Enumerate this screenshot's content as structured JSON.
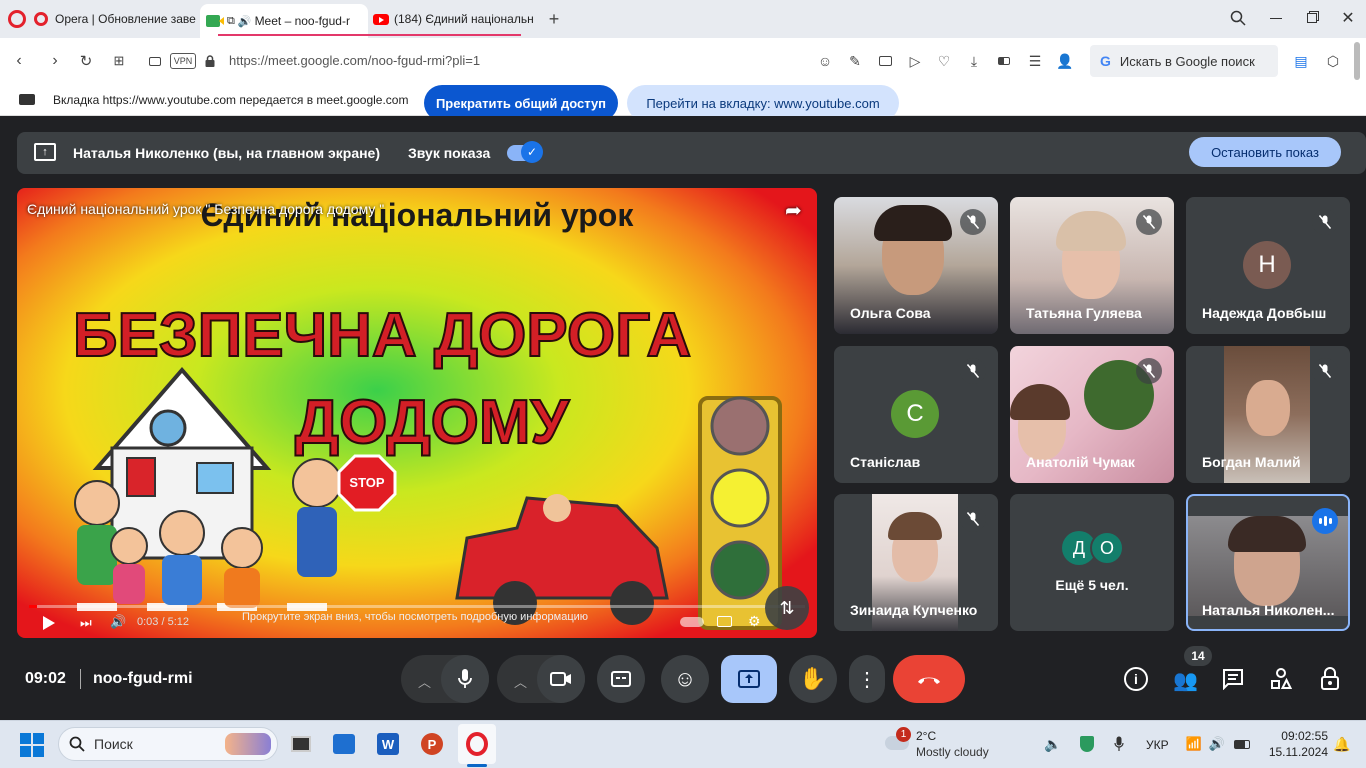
{
  "browser": {
    "tabs": [
      {
        "label": "Opera | Обновление заве"
      },
      {
        "label": "Meet – noo-fgud-r"
      },
      {
        "label": "(184) Єдиний національн"
      }
    ],
    "address_url": "https://meet.google.com/noo-fgud-rmi?pli=1",
    "vpn_label": "VPN",
    "search_placeholder": "Искать в Google поиск",
    "share_notice": "Вкладка https://www.youtube.com передается в meet.google.com",
    "stop_sharing_label": "Прекратить общий доступ",
    "goto_tab_label": "Перейти на вкладку: www.youtube.com"
  },
  "meet": {
    "presenter_label": "Наталья Николенко (вы, на главном экране)",
    "share_sound_label": "Звук показа",
    "stop_presenting_label": "Остановить показ",
    "meeting_time": "09:02",
    "meeting_code": "noo-fgud-rmi",
    "participants_count": "14",
    "video": {
      "title": "Єдиний національний урок \" Безпечна дорога додому \"",
      "banner_top": "Єдиний національний урок",
      "headline_1": "БЕЗПЕЧНА ДОРОГА",
      "headline_2": "ДОДОМУ",
      "stop_sign": "STOP",
      "time": "0:03 / 5:12",
      "scroll_hint": "Прокрутите экран вниз, чтобы посмотреть подробную информацию",
      "progress": 0.01
    },
    "participants": [
      {
        "name": "Ольга Сова"
      },
      {
        "name": "Татьяна Гуляева"
      },
      {
        "name": "Надежда Довбыш",
        "initial": "Н",
        "color": "#7a5b52"
      },
      {
        "name": "Станіслав",
        "initial": "С",
        "color": "#5a9a35"
      },
      {
        "name": "Анатолій Чумак"
      },
      {
        "name": "Богдан Малий"
      },
      {
        "name": "Зинаида Купченко"
      },
      {
        "name": "Ещё 5 чел.",
        "initials": [
          "Д",
          "О"
        ],
        "color": "#137e6b"
      },
      {
        "name": "Наталья Николен..."
      }
    ]
  },
  "taskbar": {
    "search_label": "Поиск",
    "weather_temp": "2°C",
    "weather_desc": "Mostly cloudy",
    "weather_badge": "1",
    "language": "УКР",
    "clock_time": "09:02:55",
    "clock_date": "15.11.2024"
  }
}
